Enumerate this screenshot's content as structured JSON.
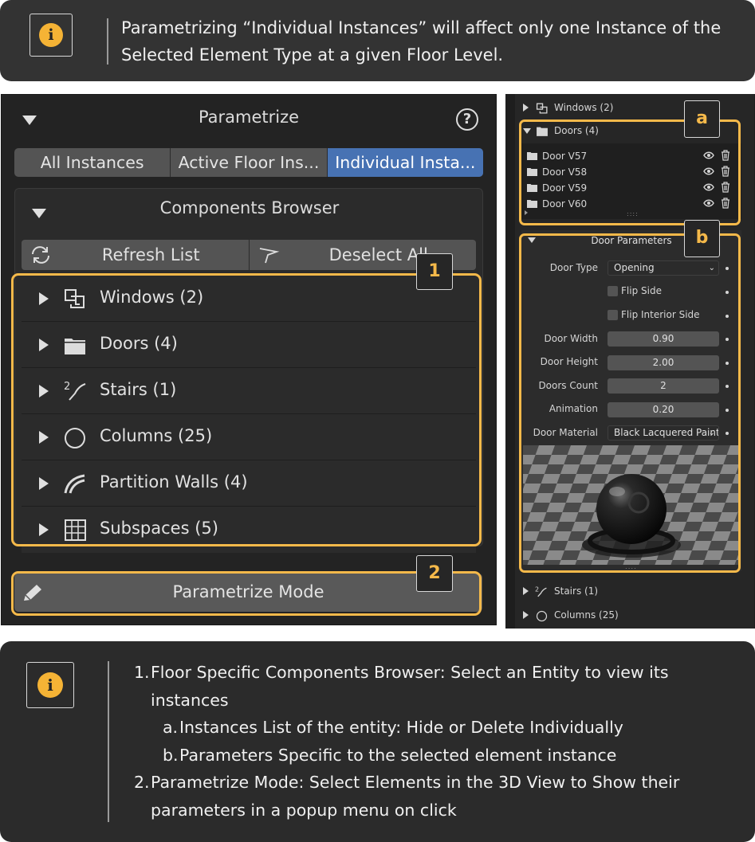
{
  "info_top": {
    "icon": "info-icon",
    "text": "Parametrizing “Individual Instances” will affect only one Instance of the Selected Element Type at a given Floor Level."
  },
  "parametrize": {
    "title": "Parametrize",
    "help": "?",
    "tabs": [
      {
        "label": "All Instances",
        "active": false
      },
      {
        "label": "Active Floor Ins...",
        "active": false
      },
      {
        "label": "Individual Insta...",
        "active": true
      }
    ],
    "components_browser": {
      "title": "Components Browser",
      "refresh_label": "Refresh List",
      "deselect_label": "Deselect All",
      "items": [
        {
          "label": "Windows (2)",
          "icon": "windows-icon"
        },
        {
          "label": "Doors (4)",
          "icon": "folder-icon"
        },
        {
          "label": "Stairs (1)",
          "icon": "stairs-icon"
        },
        {
          "label": "Columns (25)",
          "icon": "column-circle-icon"
        },
        {
          "label": "Partition Walls (4)",
          "icon": "partition-wall-icon"
        },
        {
          "label": "Subspaces (5)",
          "icon": "grid-icon"
        }
      ]
    },
    "mode_label": "Parametrize Mode"
  },
  "badges": {
    "b1": "1",
    "b2": "2",
    "ba": "a",
    "bb": "b"
  },
  "right": {
    "windows": "Windows (2)",
    "doors": "Doors (4)",
    "door_items": [
      "Door V57",
      "Door V58",
      "Door V59",
      "Door V60"
    ],
    "door_params_title": "Door Parameters",
    "props": {
      "door_type_label": "Door Type",
      "door_type_value": "Opening",
      "flip_side": "Flip Side",
      "flip_interior": "Flip Interior Side",
      "width_label": "Door Width",
      "width_value": "0.90",
      "height_label": "Door Height",
      "height_value": "2.00",
      "count_label": "Doors Count",
      "count_value": "2",
      "anim_label": "Animation",
      "anim_value": "0.20",
      "material_label": "Door Material",
      "material_value": "Black Lacquered Paint"
    },
    "stairs": "Stairs (1)",
    "columns": "Columns (25)"
  },
  "info_bottom": {
    "items": [
      {
        "num": "1.",
        "text": "Floor Specific Components Browser: Select an Entity to view its instances",
        "subs": [
          {
            "num": "a.",
            "text": "Instances List of the entity: Hide or Delete Individually"
          },
          {
            "num": "b.",
            "text": "Parameters Specific to the selected element instance"
          }
        ]
      },
      {
        "num": "2.",
        "text": "Parametrize Mode: Select Elements in the 3D View to Show their parameters in a popup menu on click"
      }
    ]
  },
  "colors": {
    "accent_orange": "#f5b94a",
    "active_tab": "#4772b3",
    "panel_bg": "#232323"
  }
}
